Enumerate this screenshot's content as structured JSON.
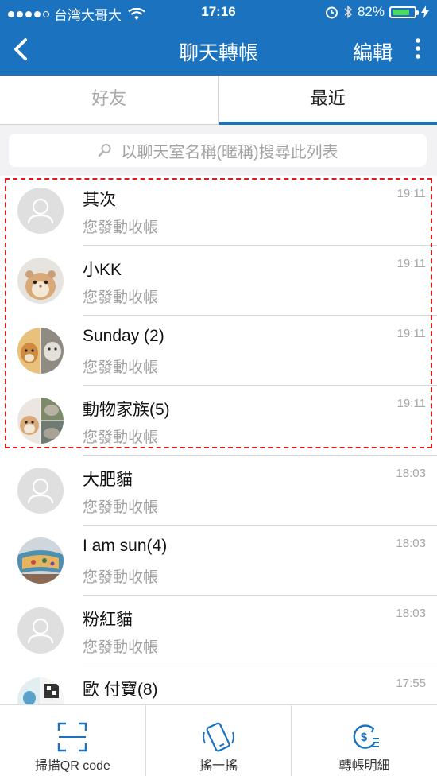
{
  "status": {
    "carrier": "台湾大哥大",
    "time": "17:16",
    "battery": "82%",
    "battery_level": 0.82
  },
  "nav": {
    "title": "聊天轉帳",
    "edit": "編輯"
  },
  "tabs": [
    {
      "label": "好友"
    },
    {
      "label": "最近"
    }
  ],
  "search": {
    "placeholder": "以聊天室名稱(暱稱)搜尋此列表"
  },
  "chats": [
    {
      "name": "其次",
      "subtitle": "您發動收帳",
      "time": "19:11"
    },
    {
      "name": "小KK",
      "subtitle": "您發動收帳",
      "time": "19:11"
    },
    {
      "name": "Sunday (2)",
      "subtitle": "您發動收帳",
      "time": "19:11"
    },
    {
      "name": "動物家族(5)",
      "subtitle": "您發動收帳",
      "time": "19:11"
    },
    {
      "name": "大肥貓",
      "subtitle": "您發動收帳",
      "time": "18:03"
    },
    {
      "name": "I am sun(4)",
      "subtitle": "您發動收帳",
      "time": "18:03"
    },
    {
      "name": "粉紅貓",
      "subtitle": "您發動收帳",
      "time": "18:03"
    },
    {
      "name": "歐 付寶(8)",
      "subtitle": "",
      "time": "17:55"
    }
  ],
  "bottom": {
    "scan": "掃描QR code",
    "shake": "搖一搖",
    "details": "轉帳明細"
  },
  "colors": {
    "primary": "#1b73c0",
    "highlight": "#e01a1a"
  }
}
